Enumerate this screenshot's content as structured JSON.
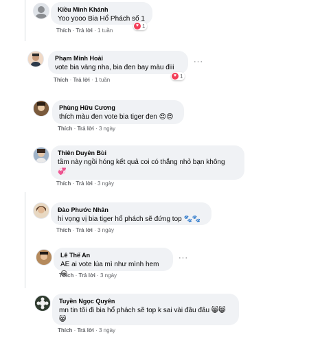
{
  "ui": {
    "like_label": "Thích",
    "reply_label": "Trả lời",
    "separator": "·",
    "more_label": "···"
  },
  "comments": [
    {
      "author": "Kiều Minh Khánh",
      "text": "Yoo yooo Bia Hổ Phách số 1",
      "emoji": "",
      "time": "1 tuần",
      "reactions": "1"
    },
    {
      "author": "Phạm Minh Hoài",
      "text": "vote bia vàng nha, bia đen bay màu điii",
      "emoji": "",
      "time": "1 tuần",
      "reactions": "1"
    },
    {
      "author": "Phùng Hữu Cương",
      "text": "thích màu đen vote bia tiger đen",
      "emoji": "😍😍",
      "time": "3 ngày",
      "reactions": ""
    },
    {
      "author": "Thiên Duyên Bùi",
      "text": "tầm này ngồi hóng kết quả coi có thắng nhỏ bạn không",
      "emoji": "💞",
      "time": "3 ngày",
      "reactions": ""
    },
    {
      "author": "Đào Phước Nhân",
      "text": "hi vọng vị bia tiger hổ phách sẽ đứng top",
      "emoji": "🐾🐾",
      "time": "3 ngày",
      "reactions": ""
    },
    {
      "author": "Lê Thế An",
      "text": "AE ai vote lúa mì như mình hem",
      "emoji": "😀",
      "time": "3 ngày",
      "reactions": ""
    },
    {
      "author": "Tuyền Ngọc Quyên",
      "text": "mn tin tôi đi bia hổ phách sẽ top k sai vài đâu đâu",
      "emoji": "😸😸",
      "emoji2": "😸",
      "time": "3 ngày",
      "reactions": ""
    }
  ]
}
